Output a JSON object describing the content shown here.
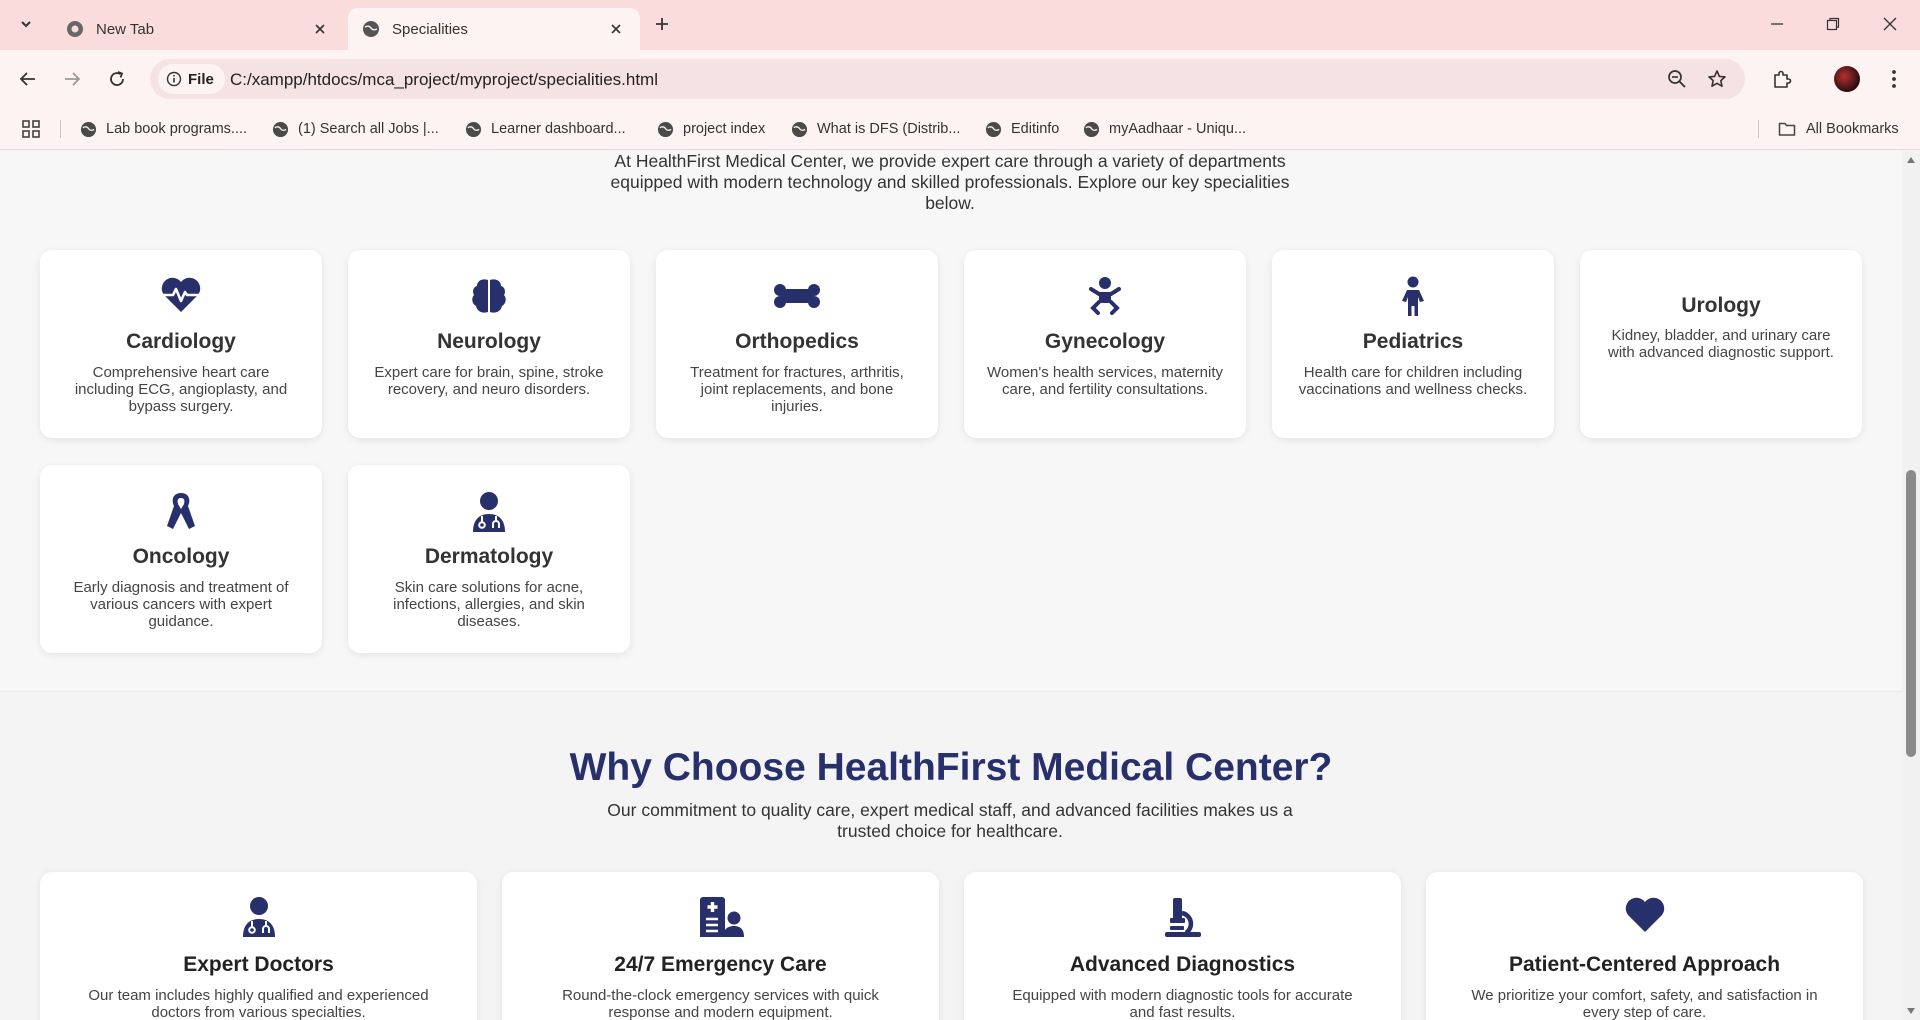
{
  "browser": {
    "tabs": [
      {
        "title": "New Tab",
        "active": false
      },
      {
        "title": "Specialities",
        "active": true
      }
    ],
    "address": {
      "chip_label": "File",
      "url": "C:/xampp/htdocs/mca_project/myproject/specialities.html"
    },
    "bookmarks": [
      "Lab book programs....",
      "(1) Search all Jobs |...",
      "Learner dashboard...",
      "project index",
      "What is DFS (Distrib...",
      "Editinfo",
      "myAadhaar - Uniqu..."
    ],
    "all_bookmarks_label": "All Bookmarks"
  },
  "page": {
    "intro": "At HealthFirst Medical Center, we provide expert care through a variety of departments equipped with modern technology and skilled professionals. Explore our key specialities below.",
    "specialities": [
      {
        "name": "Cardiology",
        "icon": "heart-pulse-icon",
        "description": "Comprehensive heart care including ECG, angioplasty, and bypass surgery."
      },
      {
        "name": "Neurology",
        "icon": "brain-icon",
        "description": "Expert care for brain, spine, stroke recovery, and neuro disorders."
      },
      {
        "name": "Orthopedics",
        "icon": "bone-icon",
        "description": "Treatment for fractures, arthritis, joint replacements, and bone injuries."
      },
      {
        "name": "Gynecology",
        "icon": "baby-icon",
        "description": "Women's health services, maternity care, and fertility consultations."
      },
      {
        "name": "Pediatrics",
        "icon": "child-icon",
        "description": "Health care for children including vaccinations and wellness checks."
      },
      {
        "name": "Urology",
        "icon": "",
        "description": "Kidney, bladder, and urinary care with advanced diagnostic support."
      },
      {
        "name": "Oncology",
        "icon": "ribbon-icon",
        "description": "Early diagnosis and treatment of various cancers with expert guidance."
      },
      {
        "name": "Dermatology",
        "icon": "doctor-icon",
        "description": "Skin care solutions for acne, infections, allergies, and skin diseases."
      }
    ],
    "why": {
      "title": "Why Choose HealthFirst Medical Center?",
      "subtitle": "Our commitment to quality care, expert medical staff, and advanced facilities makes us a trusted choice for healthcare.",
      "cards": [
        {
          "title": "Expert Doctors",
          "icon": "doctor-icon",
          "description": "Our team includes highly qualified and experienced doctors from various specialties."
        },
        {
          "title": "24/7 Emergency Care",
          "icon": "hospital-user-icon",
          "description": "Round-the-clock emergency services with quick response and modern equipment."
        },
        {
          "title": "Advanced Diagnostics",
          "icon": "microscope-icon",
          "description": "Equipped with modern diagnostic tools for accurate and fast results."
        },
        {
          "title": "Patient-Centered Approach",
          "icon": "heart-icon",
          "description": "We prioritize your comfort, safety, and satisfaction in every step of care."
        }
      ]
    }
  },
  "colors": {
    "accent": "#28306b",
    "tab_strip": "#fbdcdc",
    "toolbar": "#fdf3f3"
  }
}
